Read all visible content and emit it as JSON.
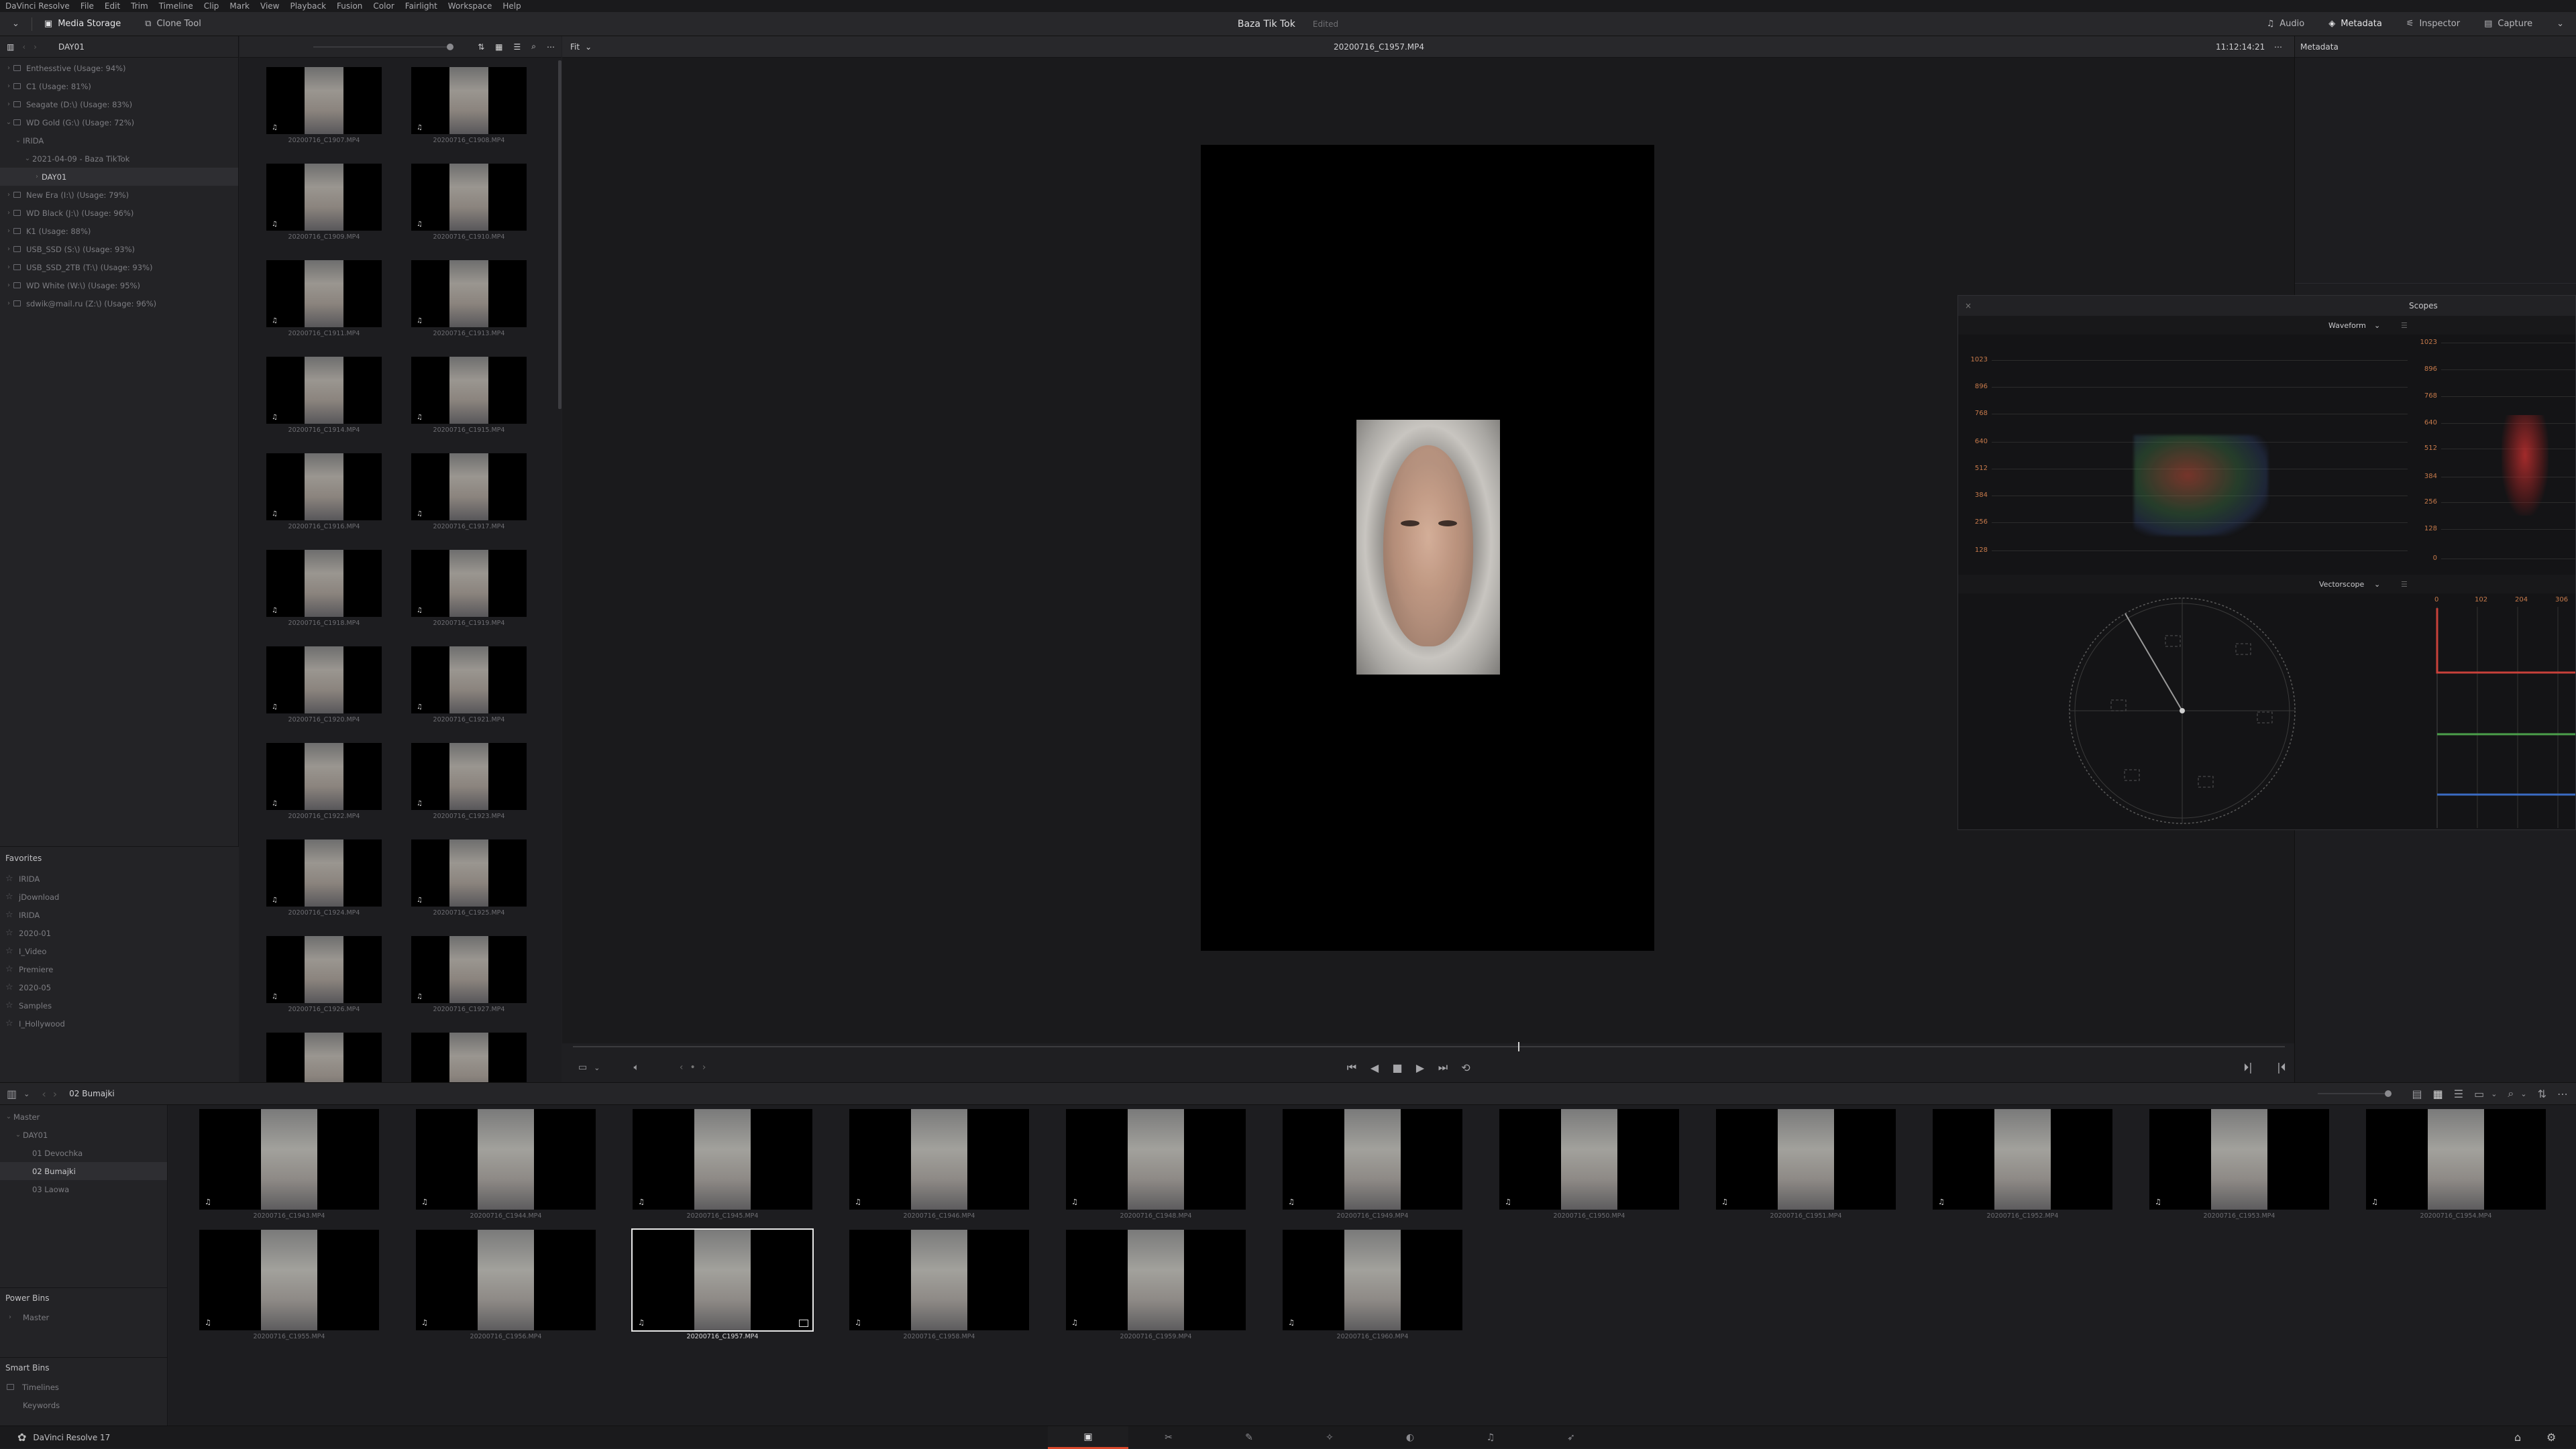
{
  "menu": [
    "DaVinci Resolve",
    "File",
    "Edit",
    "Trim",
    "Timeline",
    "Clip",
    "Mark",
    "View",
    "Playback",
    "Fusion",
    "Color",
    "Fairlight",
    "Workspace",
    "Help"
  ],
  "header": {
    "media_storage": "Media Storage",
    "clone_tool": "Clone Tool",
    "project_title": "Baza Tik Tok",
    "project_status": "Edited",
    "audio": "Audio",
    "metadata": "Metadata",
    "inspector": "Inspector",
    "capture": "Capture"
  },
  "storage": {
    "current_folder": "DAY01",
    "items": [
      {
        "label": "Enthesstive (Usage: 94%)",
        "depth": 0,
        "chev": "›"
      },
      {
        "label": "C1 (Usage: 81%)",
        "depth": 0,
        "chev": "›"
      },
      {
        "label": "Seagate (D:\\) (Usage: 83%)",
        "depth": 0,
        "chev": "›"
      },
      {
        "label": "WD Gold (G:\\) (Usage: 72%)",
        "depth": 0,
        "chev": "⌄"
      },
      {
        "label": "IRIDA",
        "depth": 1,
        "chev": "⌄"
      },
      {
        "label": "2021-04-09 - Baza TikTok",
        "depth": 2,
        "chev": "⌄"
      },
      {
        "label": "DAY01",
        "depth": 3,
        "chev": "›",
        "selected": true
      },
      {
        "label": "New Era (I:\\) (Usage: 79%)",
        "depth": 0,
        "chev": "›"
      },
      {
        "label": "WD Black (J:\\) (Usage: 96%)",
        "depth": 0,
        "chev": "›"
      },
      {
        "label": "K1 (Usage: 88%)",
        "depth": 0,
        "chev": "›"
      },
      {
        "label": "USB_SSD (S:\\) (Usage: 93%)",
        "depth": 0,
        "chev": "›"
      },
      {
        "label": "USB_SSD_2TB (T:\\) (Usage: 93%)",
        "depth": 0,
        "chev": "›"
      },
      {
        "label": "WD White (W:\\) (Usage: 95%)",
        "depth": 0,
        "chev": "›"
      },
      {
        "label": "sdwik@mail.ru (Z:\\) (Usage: 96%)",
        "depth": 0,
        "chev": "›"
      }
    ]
  },
  "favorites": {
    "title": "Favorites",
    "items": [
      "IRIDA",
      "jDownload",
      "IRIDA",
      "2020-01",
      "I_Video",
      "Premiere",
      "2020-05",
      "Samples",
      "I_Hollywood"
    ]
  },
  "media_clips": [
    "20200716_C1907.MP4",
    "20200716_C1908.MP4",
    "20200716_C1909.MP4",
    "20200716_C1910.MP4",
    "20200716_C1911.MP4",
    "20200716_C1913.MP4",
    "20200716_C1914.MP4",
    "20200716_C1915.MP4",
    "20200716_C1916.MP4",
    "20200716_C1917.MP4",
    "20200716_C1918.MP4",
    "20200716_C1919.MP4",
    "20200716_C1920.MP4",
    "20200716_C1921.MP4",
    "20200716_C1922.MP4",
    "20200716_C1923.MP4",
    "20200716_C1924.MP4",
    "20200716_C1925.MP4",
    "20200716_C1926.MP4",
    "20200716_C1927.MP4"
  ],
  "viewer": {
    "zoom": "Fit",
    "clip_name": "20200716_C1957.MP4",
    "timecode": "11:12:14:21",
    "metadata_title": "Metadata"
  },
  "scopes": {
    "title": "Scopes",
    "waveform": "Waveform",
    "vectorscope": "Vectorscope",
    "scale": [
      "1023",
      "896",
      "768",
      "640",
      "512",
      "384",
      "256",
      "128"
    ],
    "scale_right": [
      "1023",
      "896",
      "768",
      "640",
      "512",
      "384",
      "256",
      "128",
      "0"
    ],
    "parade_scale": [
      "0",
      "102",
      "204",
      "306"
    ]
  },
  "pool": {
    "current_bin": "02 Bumajki",
    "bins": [
      {
        "label": "Master",
        "depth": 0,
        "chev": "⌄"
      },
      {
        "label": "DAY01",
        "depth": 1,
        "chev": "⌄"
      },
      {
        "label": "01 Devochka",
        "depth": 2,
        "chev": ""
      },
      {
        "label": "02 Bumajki",
        "depth": 2,
        "chev": "",
        "selected": true
      },
      {
        "label": "03 Laowa",
        "depth": 2,
        "chev": ""
      }
    ],
    "power_bins": "Power Bins",
    "power_master": "Master",
    "smart_bins": "Smart Bins",
    "smart_items": [
      "Timelines",
      "Keywords"
    ],
    "clips": [
      "20200716_C1943.MP4",
      "20200716_C1944.MP4",
      "20200716_C1945.MP4",
      "20200716_C1946.MP4",
      "20200716_C1948.MP4",
      "20200716_C1949.MP4",
      "20200716_C1950.MP4",
      "20200716_C1951.MP4",
      "20200716_C1952.MP4",
      "20200716_C1953.MP4",
      "20200716_C1954.MP4",
      "20200716_C1955.MP4",
      "20200716_C1956.MP4",
      "20200716_C1957.MP4",
      "20200716_C1958.MP4",
      "20200716_C1959.MP4",
      "20200716_C1960.MP4"
    ],
    "selected_clip": "20200716_C1957.MP4"
  },
  "status": {
    "app": "DaVinci Resolve 17"
  },
  "icons": {
    "page_media": "media-page-icon",
    "page_cut": "cut-page-icon",
    "page_edit": "edit-page-icon",
    "page_fusion": "fusion-page-icon",
    "page_color": "color-page-icon",
    "page_fairlight": "fairlight-page-icon",
    "page_deliver": "deliver-page-icon"
  },
  "colors": {
    "accent": "#d9482b",
    "waveform_label": "#c77a4b",
    "selection": "#e8e8e8"
  }
}
